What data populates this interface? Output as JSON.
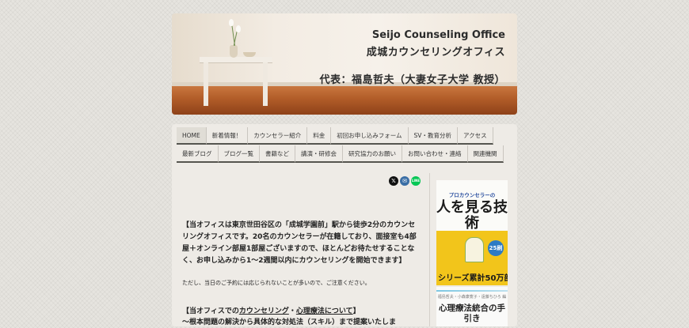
{
  "header": {
    "title_en": "Seijo Counseling Office",
    "title_jp": "成城カウンセリングオフィス",
    "representative": "代表：福島哲夫（大妻女子大学 教授）"
  },
  "nav": {
    "row1": [
      "HOME",
      "新着情報！",
      "カウンセラー紹介",
      "料金",
      "初回お申し込みフォーム",
      "SV・教育分析",
      "アクセス"
    ],
    "row2": [
      "最新ブログ",
      "ブログ一覧",
      "書籍など",
      "講演・研修会",
      "研究協力のお願い",
      "お問い合わせ・連絡",
      "関連機関"
    ],
    "active": "HOME"
  },
  "share": {
    "x": "𝕏",
    "mail": "✉",
    "line": "LINE",
    "colors": {
      "x": "#111111",
      "mail": "#3a6ea5",
      "line": "#06c755"
    }
  },
  "main": {
    "lead": "【当オフィスは東京世田谷区の「成城学園前」駅から徒歩2分のカウンセリングオフィスです。20名のカウンセラーが在籍しており、面接室も4部屋＋オンライン部屋1部屋ございますので、ほとんどお待たせすることなく、お申し込みから1～2週間以内にカウンセリングを開始できます】",
    "note": "ただし、当日のご予約には応じられないことが多いので、ご注意ください。",
    "sub_prefix": "【当オフィスでの",
    "sub_link1": "カウンセリング",
    "sub_dot": "・",
    "sub_link2": "心理療法について",
    "sub_suffix": "】",
    "sub_line2": "～根本問題の解決から具体的な対処法（スキル）まで提案いたしま"
  },
  "sidebar": {
    "book1": {
      "subtitle": "プロカウンセラーの",
      "title": "人を見る技術",
      "badge": "25刷",
      "band": "シリーズ累計50万部"
    },
    "book2": {
      "small": "福島哲夫・小森康寛子・遠藤ちひろ 編",
      "title": "心理療法統合の手引き"
    }
  }
}
